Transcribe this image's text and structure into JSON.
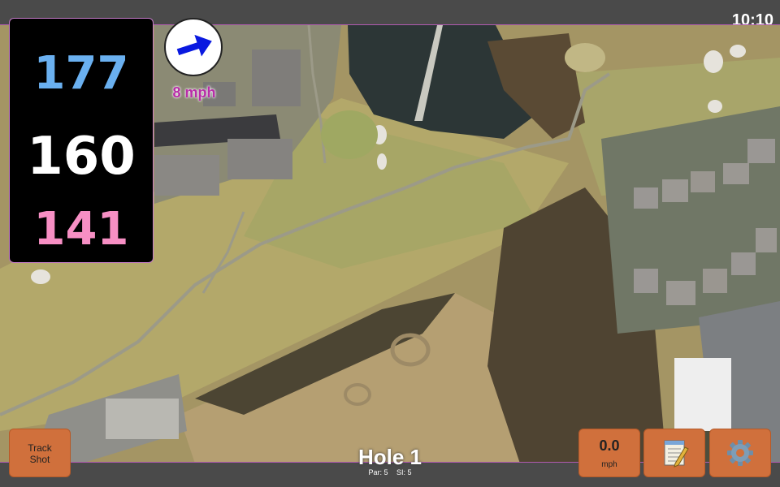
{
  "status": {
    "time": "10:10"
  },
  "yardage": {
    "back": "177",
    "middle": "160",
    "front": "141"
  },
  "wind": {
    "speed": "8 mph",
    "icon": "wind-arrow-icon"
  },
  "hole": {
    "title": "Hole 1",
    "par": "Par: 5",
    "stroke_index": "SI: 5"
  },
  "buttons": {
    "track_shot": {
      "line1": "Track",
      "line2": "Shot"
    },
    "speed": {
      "value": "0.0",
      "unit": "mph"
    },
    "notes": {
      "icon": "notepad-icon"
    },
    "settings": {
      "icon": "gear-icon"
    }
  },
  "colors": {
    "back": "#6ab0f0",
    "middle": "#ffffff",
    "front": "#f78fc4",
    "button": "#d0703c",
    "wind_text": "#b82da8",
    "wind_arrow": "#0a19e0"
  }
}
